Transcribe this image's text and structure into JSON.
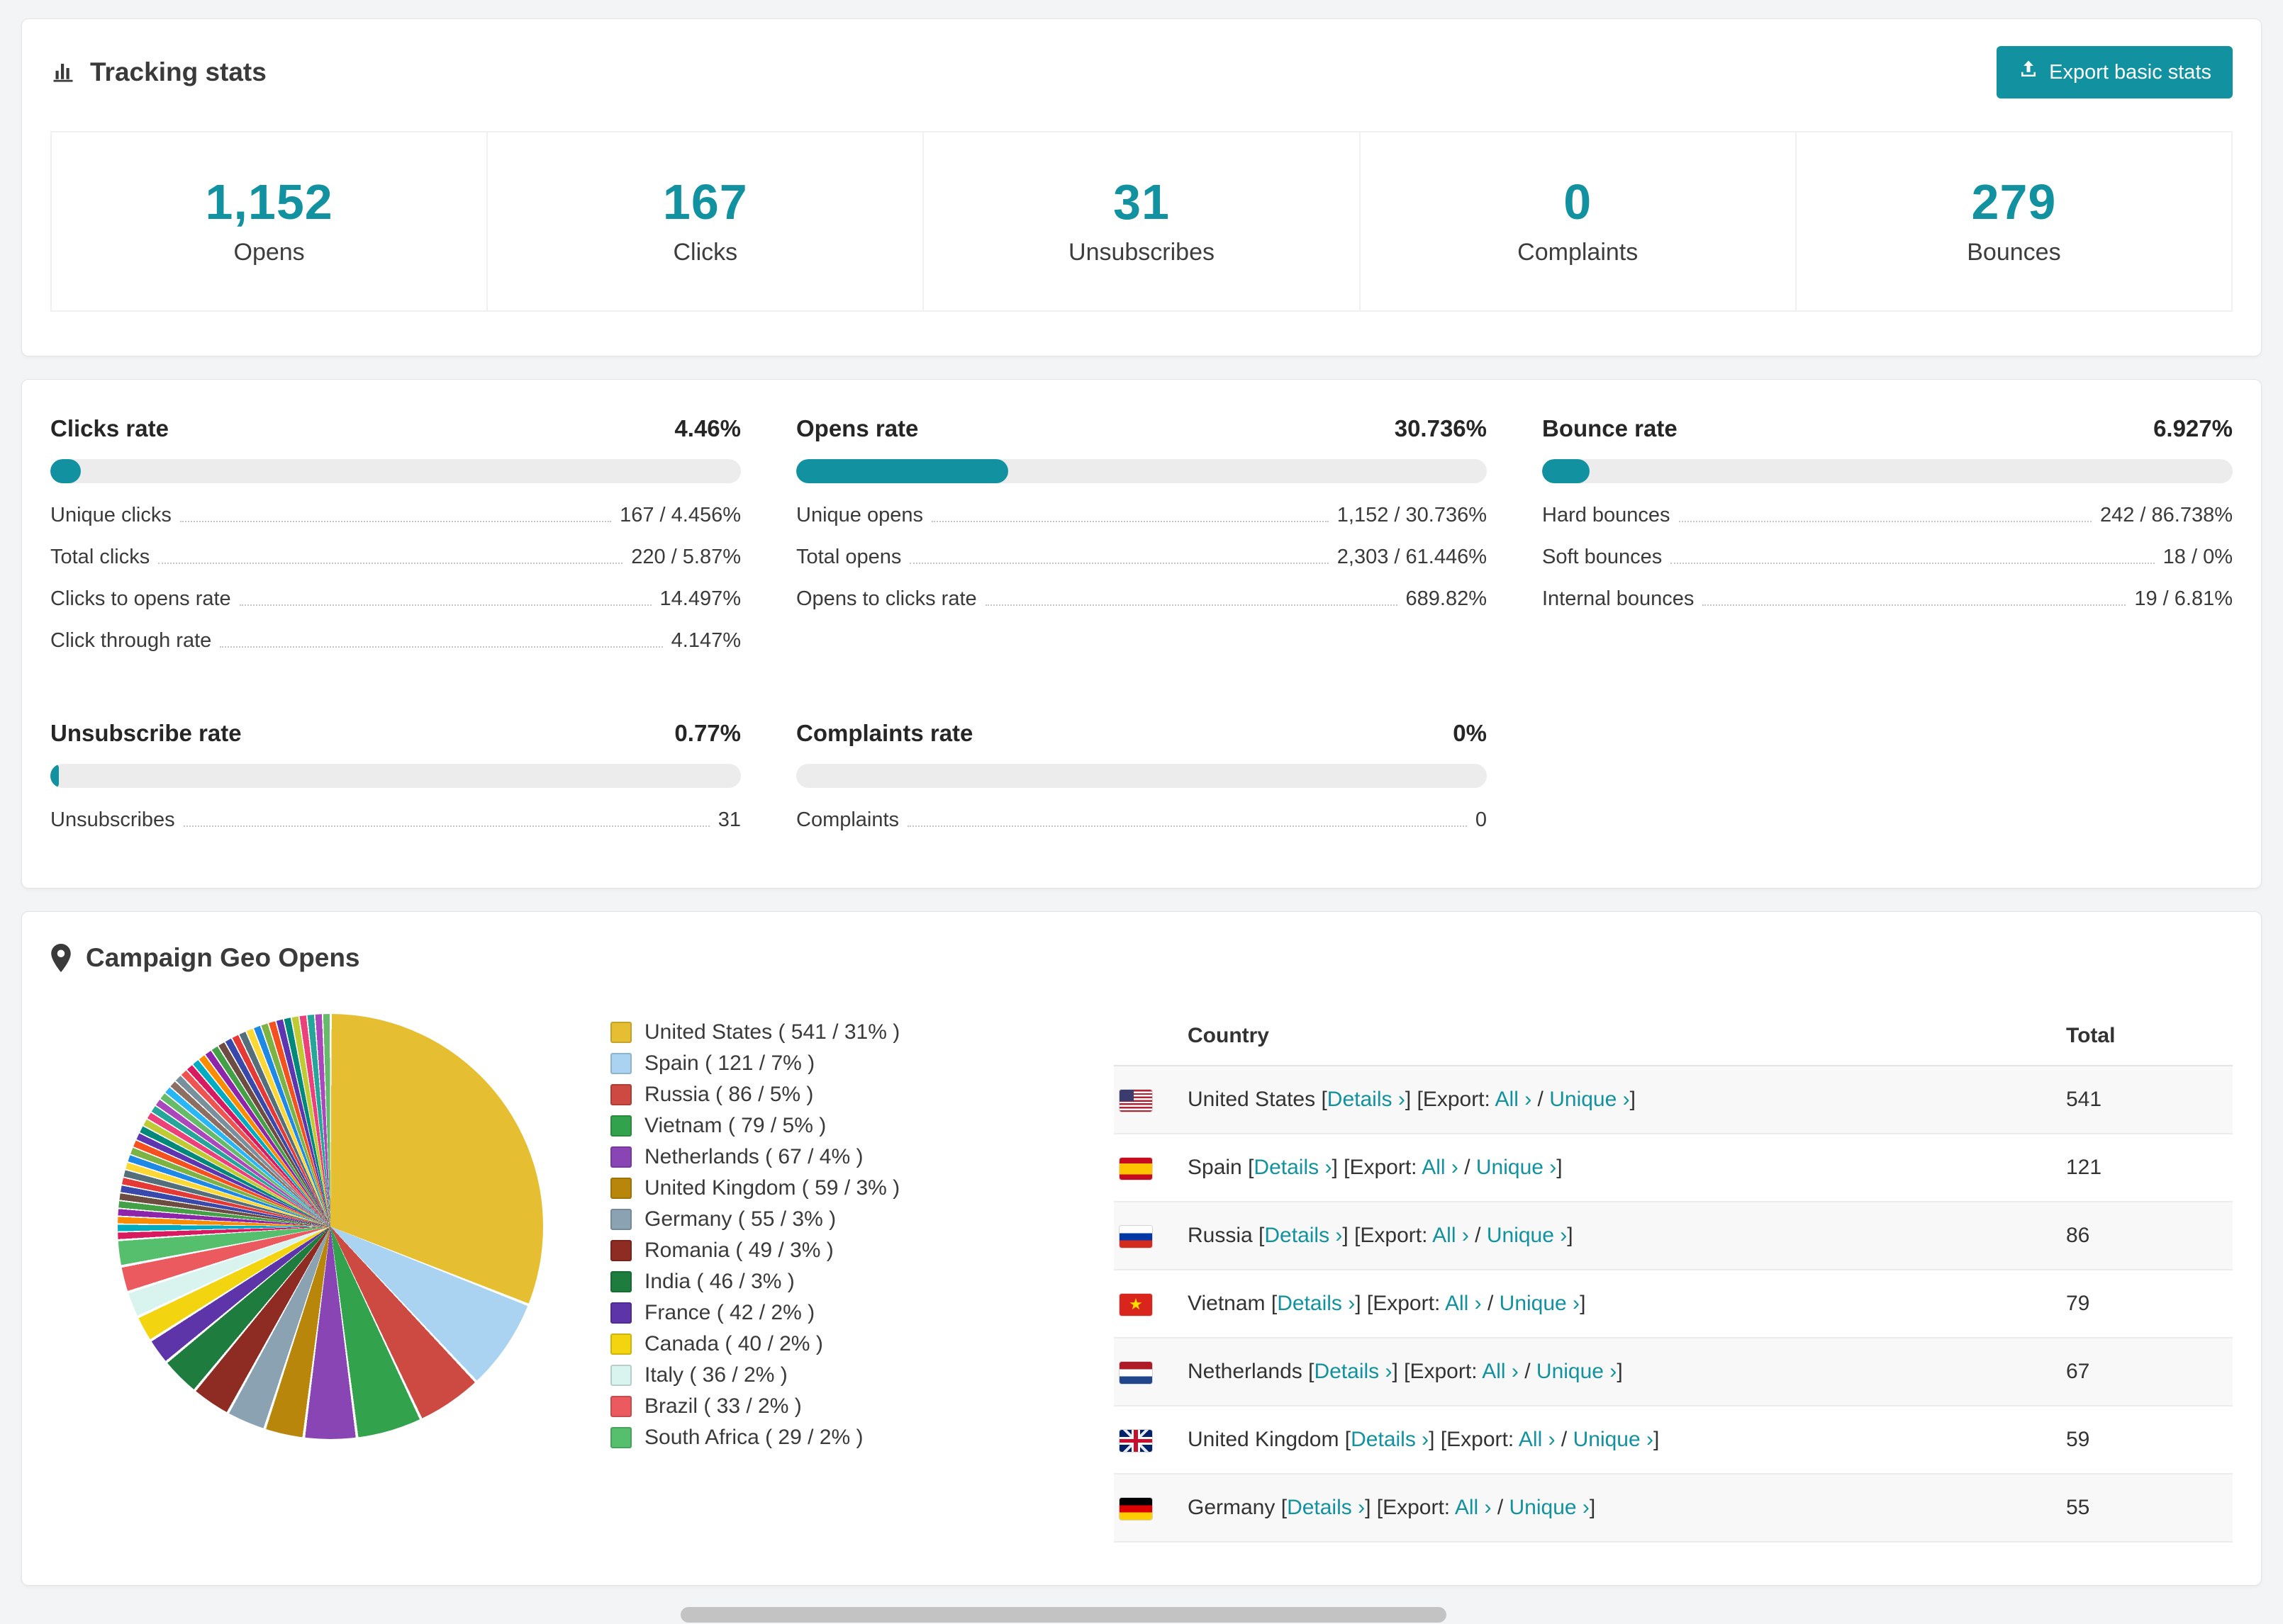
{
  "colors": {
    "accent": "#1292a0"
  },
  "tracking": {
    "title": "Tracking stats",
    "export_button": "Export basic stats",
    "stats": [
      {
        "value": "1,152",
        "label": "Opens"
      },
      {
        "value": "167",
        "label": "Clicks"
      },
      {
        "value": "31",
        "label": "Unsubscribes"
      },
      {
        "value": "0",
        "label": "Complaints"
      },
      {
        "value": "279",
        "label": "Bounces"
      }
    ]
  },
  "rates": [
    {
      "name": "Clicks rate",
      "value": "4.46%",
      "percent": 4.46,
      "rows": [
        {
          "label": "Unique clicks",
          "value": "167 / 4.456%"
        },
        {
          "label": "Total clicks",
          "value": "220 / 5.87%"
        },
        {
          "label": "Clicks to opens rate",
          "value": "14.497%"
        },
        {
          "label": "Click through rate",
          "value": "4.147%"
        }
      ]
    },
    {
      "name": "Opens rate",
      "value": "30.736%",
      "percent": 30.736,
      "rows": [
        {
          "label": "Unique opens",
          "value": "1,152 / 30.736%"
        },
        {
          "label": "Total opens",
          "value": "2,303 / 61.446%"
        },
        {
          "label": "Opens to clicks rate",
          "value": "689.82%"
        }
      ]
    },
    {
      "name": "Bounce rate",
      "value": "6.927%",
      "percent": 6.927,
      "rows": [
        {
          "label": "Hard bounces",
          "value": "242 / 86.738%"
        },
        {
          "label": "Soft bounces",
          "value": "18 / 0%"
        },
        {
          "label": "Internal bounces",
          "value": "19 / 6.81%"
        }
      ]
    },
    {
      "name": "Unsubscribe rate",
      "value": "0.77%",
      "percent": 0.77,
      "rows": [
        {
          "label": "Unsubscribes",
          "value": "31"
        }
      ]
    },
    {
      "name": "Complaints rate",
      "value": "0%",
      "percent": 0,
      "rows": [
        {
          "label": "Complaints",
          "value": "0"
        }
      ]
    }
  ],
  "geo": {
    "title": "Campaign Geo Opens",
    "table": {
      "headers": [
        "Country",
        "Total"
      ],
      "details_label": "Details",
      "export_label": "Export:",
      "all_label": "All",
      "unique_label": "Unique",
      "rows": [
        {
          "country": "United States",
          "flag": "us",
          "total": "541"
        },
        {
          "country": "Spain",
          "flag": "es",
          "total": "121"
        },
        {
          "country": "Russia",
          "flag": "ru",
          "total": "86"
        },
        {
          "country": "Vietnam",
          "flag": "vn",
          "total": "79"
        },
        {
          "country": "Netherlands",
          "flag": "nl",
          "total": "67"
        },
        {
          "country": "United Kingdom",
          "flag": "gb",
          "total": "59"
        },
        {
          "country": "Germany",
          "flag": "de",
          "total": "55"
        }
      ]
    }
  },
  "chart_data": {
    "type": "pie",
    "title": "Campaign Geo Opens",
    "legend_position": "right",
    "slices": [
      {
        "label": "United States",
        "count": 541,
        "percent": 31,
        "color": "#e5be32"
      },
      {
        "label": "Spain",
        "count": 121,
        "percent": 7,
        "color": "#a9d3f0"
      },
      {
        "label": "Russia",
        "count": 86,
        "percent": 5,
        "color": "#cc4a42"
      },
      {
        "label": "Vietnam",
        "count": 79,
        "percent": 5,
        "color": "#33a24c"
      },
      {
        "label": "Netherlands",
        "count": 67,
        "percent": 4,
        "color": "#8a45b5"
      },
      {
        "label": "United Kingdom",
        "count": 59,
        "percent": 3,
        "color": "#b8860b"
      },
      {
        "label": "Germany",
        "count": 55,
        "percent": 3,
        "color": "#8aa2b2"
      },
      {
        "label": "Romania",
        "count": 49,
        "percent": 3,
        "color": "#8e2b23"
      },
      {
        "label": "India",
        "count": 46,
        "percent": 3,
        "color": "#1e7d3e"
      },
      {
        "label": "France",
        "count": 42,
        "percent": 2,
        "color": "#5d35a9"
      },
      {
        "label": "Canada",
        "count": 40,
        "percent": 2,
        "color": "#f2d411"
      },
      {
        "label": "Italy",
        "count": 36,
        "percent": 2,
        "color": "#d9f3ef"
      },
      {
        "label": "Brazil",
        "count": 33,
        "percent": 2,
        "color": "#ea5a5e"
      },
      {
        "label": "South Africa",
        "count": 29,
        "percent": 2,
        "color": "#55bf6e"
      }
    ],
    "others_percent_total": 26,
    "others_slice_count": 44,
    "others_palette": [
      "#d81b60",
      "#00acc1",
      "#fb8c00",
      "#8e24aa",
      "#43a047",
      "#6d4c41",
      "#3949ab",
      "#e53935",
      "#546e7a",
      "#fdd835",
      "#1e88e5",
      "#7cb342",
      "#f4511e",
      "#5e35b1",
      "#00897b",
      "#c0ca33",
      "#ec407a",
      "#26a69a",
      "#ab47bc",
      "#66bb6a",
      "#29b6f6",
      "#8d6e63",
      "#78909c",
      "#ef5350"
    ]
  }
}
